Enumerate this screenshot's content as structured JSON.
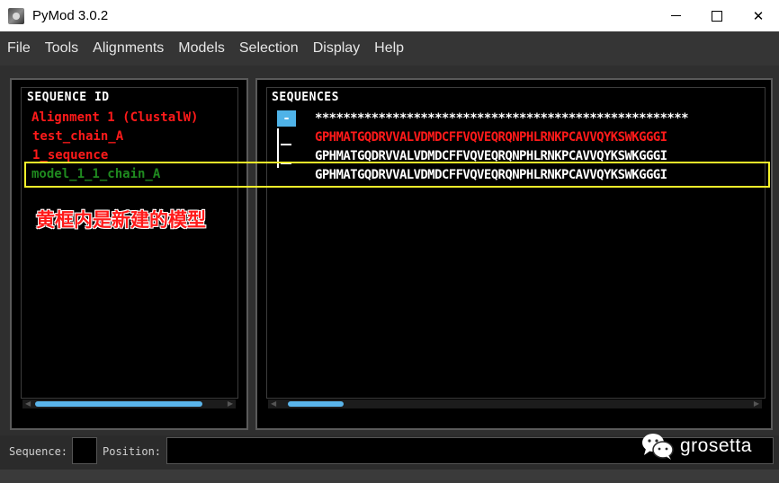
{
  "window": {
    "title": "PyMod 3.0.2",
    "minimize_glyph": "",
    "maximize_glyph": "",
    "close_glyph": "✕"
  },
  "menu": {
    "items": [
      "File",
      "Tools",
      "Alignments",
      "Models",
      "Selection",
      "Display",
      "Help"
    ]
  },
  "left_panel": {
    "header": "SEQUENCE ID",
    "items": [
      {
        "label": "Alignment 1 (ClustalW)",
        "color": "#ff1a1a"
      },
      {
        "label": "test_chain_A",
        "color": "#ff1a1a"
      },
      {
        "label": "1_sequence",
        "color": "#ff1a1a"
      },
      {
        "label": "model_1_1_chain_A",
        "color": "#1f8a1f"
      }
    ]
  },
  "right_panel": {
    "header": "SEQUENCES",
    "collapse_button_label": "-",
    "rows": [
      {
        "text": "*****************************************************",
        "color": "#ffffff"
      },
      {
        "text": "GPHMATGQDRVVALVDMDCFFVQVEQRQNPHLRNKPCAVVQYKSWKGGGI",
        "color": "#ff1a1a"
      },
      {
        "text": "GPHMATGQDRVVALVDMDCFFVQVEQRQNPHLRNKPCAVVQYKSWKGGGI",
        "color": "#ffffff"
      },
      {
        "text": "GPHMATGQDRVVALVDMDCFFVQVEQRQNPHLRNKPCAVVQYKSWKGGGI",
        "color": "#ffffff"
      }
    ]
  },
  "annotation": {
    "text": "黄框内是新建的模型",
    "box_color": "#f4f12a",
    "text_color": "#ff1a1a"
  },
  "statusbar": {
    "sequence_label": "Sequence:",
    "sequence_value": "",
    "position_label": "Position:",
    "position_value": ""
  },
  "watermark": {
    "text": "grosetta",
    "icon": "wechat-icon"
  },
  "colors": {
    "accent": "#5ab4ea",
    "panel_bg": "#000000",
    "chrome_bg": "#353535"
  }
}
